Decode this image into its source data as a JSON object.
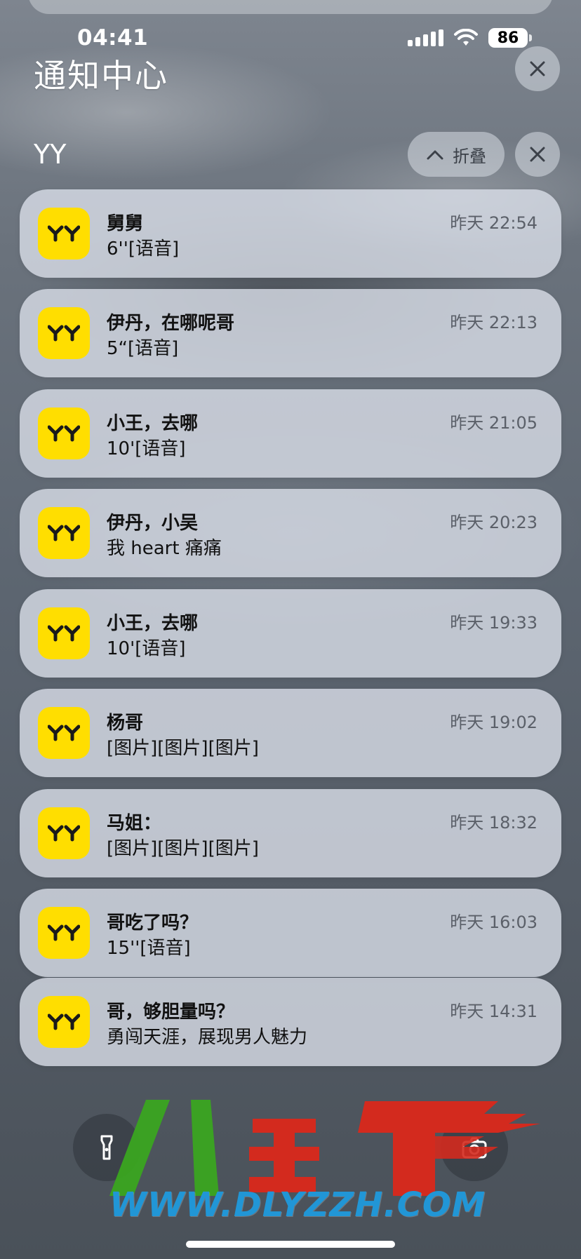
{
  "status_bar": {
    "time": "04:41",
    "battery": "86"
  },
  "notification_center": {
    "title": "通知中心"
  },
  "group": {
    "app_name": "YY",
    "collapse_label": "折叠"
  },
  "notifications": [
    {
      "title": "舅舅",
      "body": "6''[语音]",
      "time": "昨天 22:54"
    },
    {
      "title": "伊丹，在哪呢哥",
      "body": "5“[语音]",
      "time": "昨天 22:13"
    },
    {
      "title": "小王，去哪",
      "body": "10'[语音]",
      "time": "昨天 21:05"
    },
    {
      "title": "伊丹，小吴",
      "body": "我 heart 痛痛",
      "time": "昨天 20:23"
    },
    {
      "title": "小王，去哪",
      "body": "10'[语音]",
      "time": "昨天 19:33"
    },
    {
      "title": "杨哥",
      "body": "[图片][图片][图片]",
      "time": "昨天 19:02"
    },
    {
      "title": "马姐：",
      "body": "[图片][图片][图片]",
      "time": "昨天 18:32"
    },
    {
      "title": "哥吃了吗？",
      "body": "15''[语音]",
      "time": "昨天 16:03"
    },
    {
      "title": "哥，够胆量吗？",
      "body": "勇闯天涯，展现男人魅力",
      "time": "昨天 14:31"
    }
  ],
  "watermark": {
    "text": "WWW.DLYZZH.COM"
  },
  "colors": {
    "app_icon": "#ffde00",
    "card": "#dadee8",
    "watermark_blue": "#2196d6"
  },
  "icons": [
    "close-icon",
    "chevron-up-icon",
    "yy-logo-icon",
    "flashlight-icon",
    "camera-icon",
    "wifi-icon",
    "signal-icon"
  ]
}
